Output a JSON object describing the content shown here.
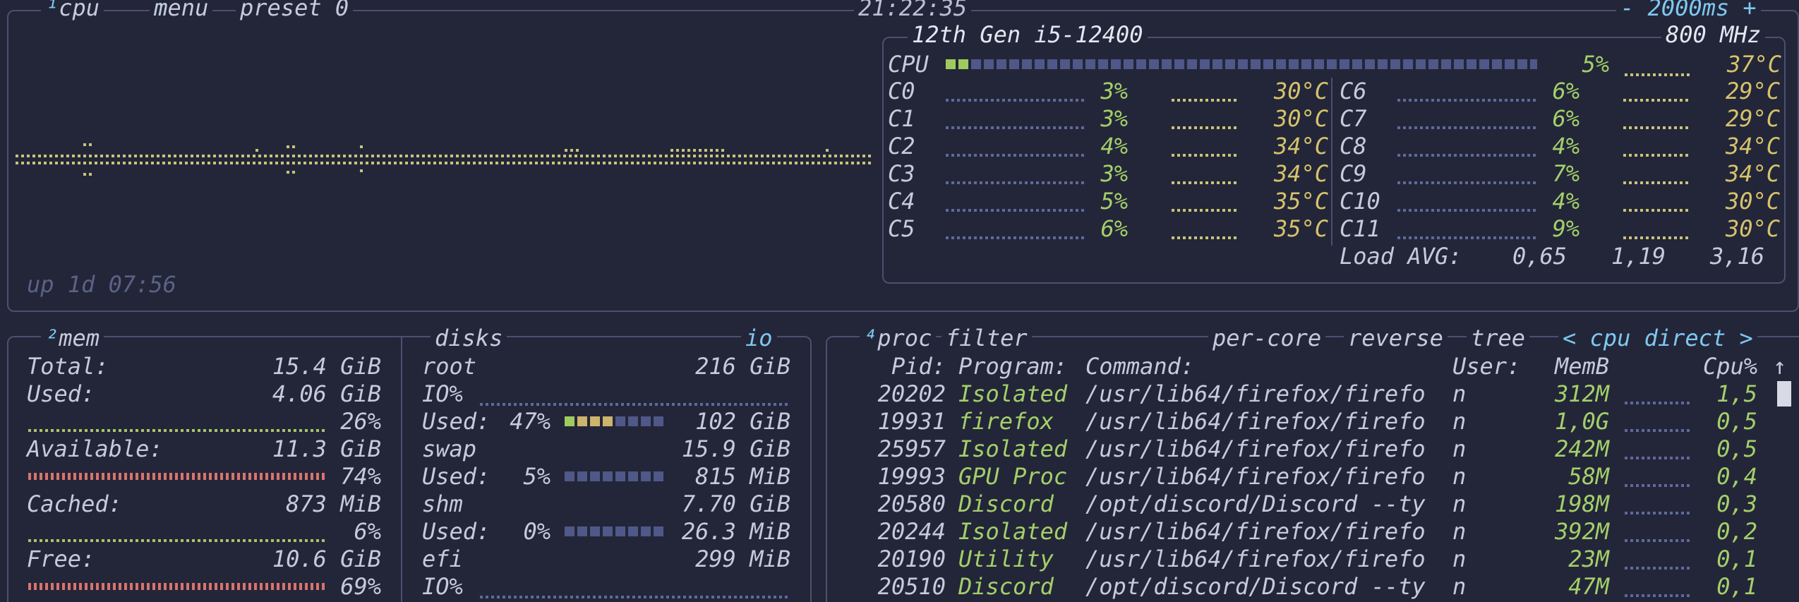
{
  "cpu_box": {
    "tab_num": "¹",
    "tab_cpu": "cpu",
    "menu": "menu",
    "preset": "preset 0",
    "clock": "21:22:35",
    "interval": "- 2000ms +",
    "uptime": "up 1d 07:56",
    "cpu_name": "12th Gen i5-12400",
    "freq": "800 MHz",
    "total": {
      "label": "CPU",
      "pct": "5%",
      "temp": "37°C",
      "fill": 0.05
    },
    "cores_left": [
      {
        "label": "C0",
        "pct": "3%",
        "temp": "30°C"
      },
      {
        "label": "C1",
        "pct": "3%",
        "temp": "30°C"
      },
      {
        "label": "C2",
        "pct": "4%",
        "temp": "34°C"
      },
      {
        "label": "C3",
        "pct": "3%",
        "temp": "34°C"
      },
      {
        "label": "C4",
        "pct": "5%",
        "temp": "35°C"
      },
      {
        "label": "C5",
        "pct": "6%",
        "temp": "35°C"
      }
    ],
    "cores_right": [
      {
        "label": "C6",
        "pct": "6%",
        "temp": "29°C"
      },
      {
        "label": "C7",
        "pct": "6%",
        "temp": "29°C"
      },
      {
        "label": "C8",
        "pct": "4%",
        "temp": "34°C"
      },
      {
        "label": "C9",
        "pct": "7%",
        "temp": "34°C"
      },
      {
        "label": "C10",
        "pct": "4%",
        "temp": "30°C"
      },
      {
        "label": "C11",
        "pct": "9%",
        "temp": "30°C"
      }
    ],
    "load_label": "Load AVG:",
    "load": [
      "0,65",
      "1,19",
      "3,16"
    ]
  },
  "mem_box": {
    "tab_num": "²",
    "tab_mem": "mem",
    "total_label": "Total:",
    "total_val": "15.4 GiB",
    "used_label": "Used:",
    "used_val": "4.06 GiB",
    "used_pct": "26%",
    "avail_label": "Available:",
    "avail_val": "11.3 GiB",
    "avail_pct": "74%",
    "cached_label": "Cached:",
    "cached_val": "873 MiB",
    "cached_pct": "6%",
    "free_label": "Free:",
    "free_val": "10.6 GiB",
    "free_pct": "69%"
  },
  "disks_box": {
    "title": "disks",
    "io": "io",
    "rows": [
      {
        "name": "root",
        "size": "216 GiB",
        "io_label": "IO%",
        "used_label": "Used:",
        "used_pct": "47%",
        "used_val": "102 GiB"
      },
      {
        "name": "swap",
        "size": "15.9 GiB",
        "used_label": "Used:",
        "used_pct": "5%",
        "used_val": "815 MiB"
      },
      {
        "name": "shm",
        "size": "7.70 GiB",
        "used_label": "Used:",
        "used_pct": "0%",
        "used_val": "26.3 MiB"
      },
      {
        "name": "efi",
        "size": "299 MiB",
        "io_label": "IO%"
      }
    ]
  },
  "proc_box": {
    "tab_num": "⁴",
    "tab_proc": "proc",
    "filter": "filter",
    "per_core": "per-core",
    "reverse": "reverse",
    "tree": "tree",
    "sort": "< cpu direct >",
    "headers": {
      "pid": "Pid:",
      "program": "Program:",
      "command": "Command:",
      "user": "User:",
      "mem": "MemB",
      "cpu": "Cpu%",
      "arrow": "↑"
    },
    "rows": [
      {
        "pid": "20202",
        "program": "Isolated",
        "command": "/usr/lib64/firefox/firefo",
        "user": "n",
        "mem": "312M",
        "cpu": "1,5"
      },
      {
        "pid": "19931",
        "program": "firefox",
        "command": "/usr/lib64/firefox/firefo",
        "user": "n",
        "mem": "1,0G",
        "cpu": "0,5"
      },
      {
        "pid": "25957",
        "program": "Isolated",
        "command": "/usr/lib64/firefox/firefo",
        "user": "n",
        "mem": "242M",
        "cpu": "0,5"
      },
      {
        "pid": "19993",
        "program": "GPU Proc",
        "command": "/usr/lib64/firefox/firefo",
        "user": "n",
        "mem": "58M",
        "cpu": "0,4"
      },
      {
        "pid": "20580",
        "program": "Discord",
        "command": "/opt/discord/Discord --ty",
        "user": "n",
        "mem": "198M",
        "cpu": "0,3"
      },
      {
        "pid": "20244",
        "program": "Isolated",
        "command": "/usr/lib64/firefox/firefo",
        "user": "n",
        "mem": "392M",
        "cpu": "0,2"
      },
      {
        "pid": "20190",
        "program": "Utility",
        "command": "/usr/lib64/firefox/firefo",
        "user": "n",
        "mem": "23M",
        "cpu": "0,1"
      },
      {
        "pid": "20510",
        "program": "Discord",
        "command": "/opt/discord/Discord --ty",
        "user": "n",
        "mem": "47M",
        "cpu": "0,1"
      }
    ]
  },
  "colors": {
    "bg": "#232638",
    "border": "#4b5070",
    "accent": "#7ec8f2",
    "green": "#a4cf6a",
    "temp": "#d6c26c",
    "red": "#d9736b"
  }
}
